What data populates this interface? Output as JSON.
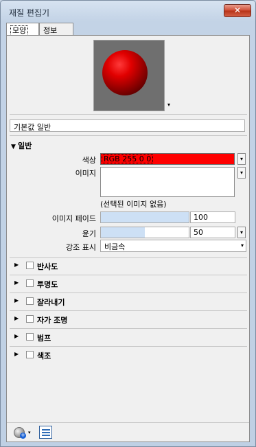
{
  "window": {
    "title": "재질 편집기",
    "close_label": "✕"
  },
  "tabs": [
    {
      "label": "모양",
      "active": true
    },
    {
      "label": "정보",
      "active": false
    }
  ],
  "material_name": "기본값 일반",
  "general": {
    "header": "일반",
    "color_label": "색상",
    "color_value": "RGB 255 0 0",
    "color_hex": "#ff0000",
    "image_label": "이미지",
    "no_image_text": "(선택된 이미지 없음)",
    "image_fade_label": "이미지 페이드",
    "image_fade_value": "100",
    "image_fade_fraction": 1.0,
    "gloss_label": "윤기",
    "gloss_value": "50",
    "gloss_fraction": 0.5,
    "highlight_label": "강조 표시",
    "highlight_value": "비금속"
  },
  "sections": [
    {
      "label": "반사도"
    },
    {
      "label": "투명도"
    },
    {
      "label": "잘라내기"
    },
    {
      "label": "자가 조명"
    },
    {
      "label": "범프"
    },
    {
      "label": "색조"
    }
  ],
  "icons": {
    "expanded": "▼",
    "collapsed": "▶",
    "dropdown": "▾",
    "plus": "+"
  }
}
